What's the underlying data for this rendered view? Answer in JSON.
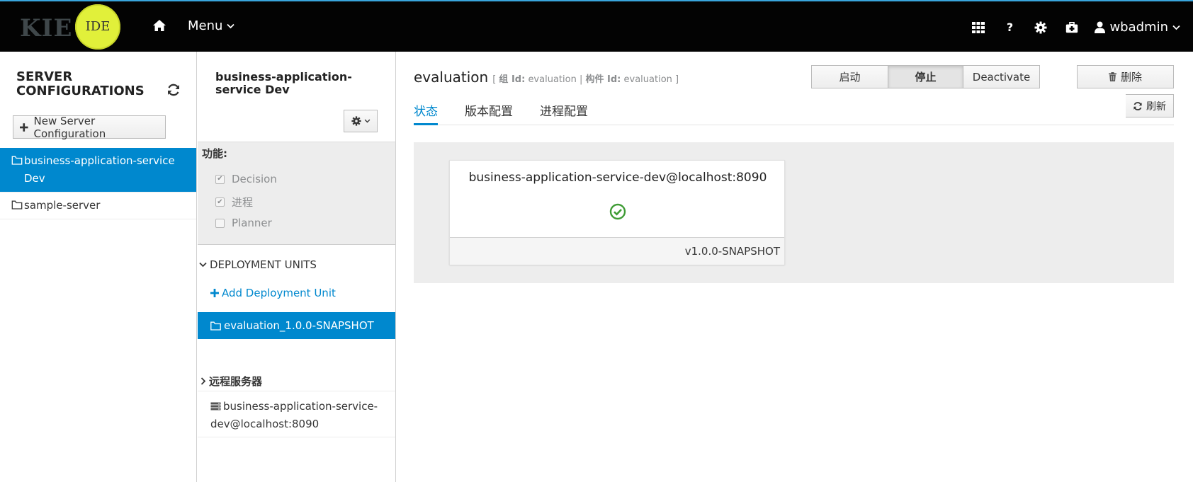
{
  "topbar": {
    "logo_kie": "KIE",
    "logo_ide": "IDE",
    "menu_label": "Menu",
    "help_label": "?",
    "user_name": "wbadmin"
  },
  "left": {
    "title": "SERVER CONFIGURATIONS",
    "new_config_label": "New Server Configuration",
    "items": [
      {
        "label": "business-application-service Dev",
        "active": true
      },
      {
        "label": "sample-server",
        "active": false
      }
    ]
  },
  "middle": {
    "title": "business-application-service Dev",
    "features_label": "功能:",
    "features": [
      {
        "label": "Decision",
        "checked": true
      },
      {
        "label": "进程",
        "checked": true
      },
      {
        "label": "Planner",
        "checked": false
      }
    ],
    "deployment_units_label": "DEPLOYMENT UNITS",
    "add_deployment_unit_label": "Add Deployment Unit",
    "deployment_units": [
      {
        "label": "evaluation_1.0.0-SNAPSHOT"
      }
    ],
    "remote_servers_label": "远程服务器",
    "remote_servers": [
      {
        "label": "business-application-service-dev@localhost:8090"
      }
    ]
  },
  "main": {
    "title": "evaluation",
    "meta_open": "[",
    "group_id_label": "组 Id:",
    "group_id": "evaluation",
    "separator": "|",
    "artifact_id_label": "构件 Id:",
    "artifact_id": "evaluation",
    "meta_close": "]",
    "buttons": {
      "start": "启动",
      "stop": "停止",
      "deactivate": "Deactivate",
      "delete": "删除",
      "refresh": "刷新"
    },
    "tabs": [
      {
        "label": "状态",
        "active": true
      },
      {
        "label": "版本配置",
        "active": false
      },
      {
        "label": "进程配置",
        "active": false
      }
    ],
    "card": {
      "server": "business-application-service-dev@localhost:8090",
      "status_icon": "check-circle-icon",
      "version": "v1.0.0-SNAPSHOT"
    }
  },
  "colors": {
    "accent": "#0088ce",
    "topbar_bg": "#030303",
    "status_ok": "#3f9c35",
    "logo_ide_bg": "#e1f03a"
  }
}
